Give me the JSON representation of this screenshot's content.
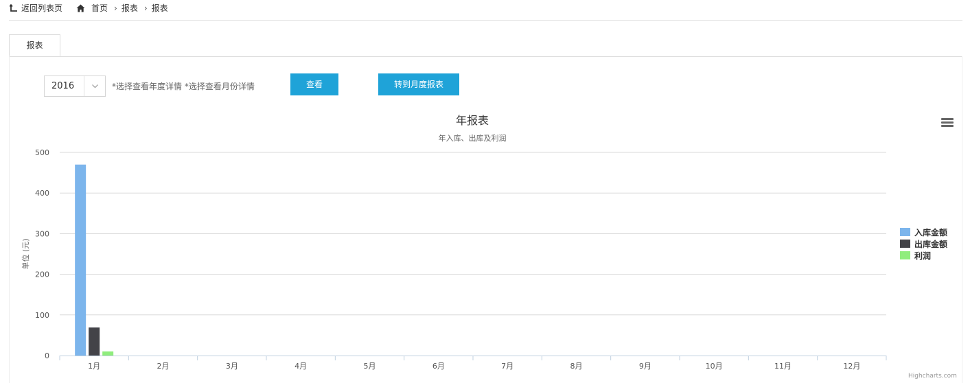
{
  "nav": {
    "back_label": "返回列表页",
    "breadcrumb": [
      "首页",
      "报表",
      "报表"
    ]
  },
  "tabs": [
    {
      "label": "报表",
      "active": true
    }
  ],
  "controls": {
    "year_value": "2016",
    "hint": "*选择查看年度详情 *选择查看月份详情",
    "view_button": "查看",
    "month_report_button": "转到月度报表",
    "button_color": "#1fa3d8"
  },
  "chart_data": {
    "type": "bar",
    "title": "年报表",
    "subtitle": "年入库、出库及利润",
    "ylabel": "单位 (元)",
    "xlabel": "",
    "ylim": [
      0,
      500
    ],
    "yticks": [
      0,
      100,
      200,
      300,
      400,
      500
    ],
    "grid": true,
    "legend_position": "right",
    "categories": [
      "1月",
      "2月",
      "3月",
      "4月",
      "5月",
      "6月",
      "7月",
      "8月",
      "9月",
      "10月",
      "11月",
      "12月"
    ],
    "series": [
      {
        "name": "入库金额",
        "color": "#7cb5ec",
        "values": [
          470,
          0,
          0,
          0,
          0,
          0,
          0,
          0,
          0,
          0,
          0,
          0
        ]
      },
      {
        "name": "出库金额",
        "color": "#434348",
        "values": [
          69,
          0,
          0,
          0,
          0,
          0,
          0,
          0,
          0,
          0,
          0,
          0
        ]
      },
      {
        "name": "利润",
        "color": "#90ed7d",
        "values": [
          10,
          0,
          0,
          0,
          0,
          0,
          0,
          0,
          0,
          0,
          0,
          0
        ]
      }
    ],
    "credit": "Highcharts.com"
  }
}
